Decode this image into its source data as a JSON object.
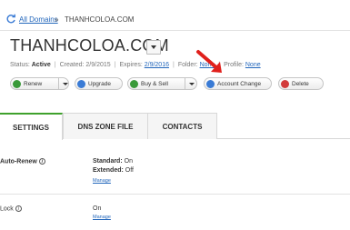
{
  "breadcrumb": {
    "link": "All Domains",
    "separator": "»",
    "current": "THANHCOLOA.COM"
  },
  "domain": {
    "title": "THANHCOLOA.COM"
  },
  "status": {
    "status_label": "Status:",
    "status_value": "Active",
    "created_label": "Created:",
    "created_value": "2/9/2015",
    "expires_label": "Expires:",
    "expires_value": "2/9/2016",
    "folder_label": "Folder:",
    "folder_value": "None",
    "profile_label": "Profile:",
    "profile_value": "None"
  },
  "actions": {
    "renew": "Renew",
    "upgrade": "Upgrade",
    "buy_sell": "Buy & Sell",
    "account_change": "Account Change",
    "delete": "Delete"
  },
  "tabs": {
    "settings": "SETTINGS",
    "dns": "DNS ZONE FILE",
    "contacts": "CONTACTS"
  },
  "settings": {
    "auto_renew": {
      "label": "Auto-Renew",
      "standard_label": "Standard:",
      "standard_value": "On",
      "extended_label": "Extended:",
      "extended_value": "Off",
      "manage": "Manage"
    },
    "lock": {
      "label": "Lock",
      "value": "On",
      "manage": "Manage"
    }
  },
  "colors": {
    "link": "#2266bb",
    "active_tab_accent": "#3fa12c",
    "arrow": "#e0201c"
  }
}
